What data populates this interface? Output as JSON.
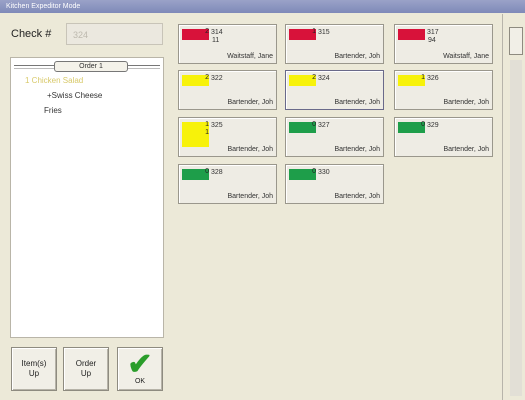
{
  "window": {
    "title": "Kitchen Expeditor Mode"
  },
  "check": {
    "label": "Check #",
    "value": "324"
  },
  "order": {
    "header": "Order 1",
    "items": [
      "1 Chicken Salad",
      "+Swiss Cheese",
      "Fries"
    ]
  },
  "buttons": {
    "items_up": [
      "Item(s)",
      "Up"
    ],
    "order_up": [
      "Order",
      "Up"
    ],
    "ok": "OK"
  },
  "colors": {
    "red": "#d8123a",
    "yellow": "#f7f20a",
    "green": "#1e9e4a"
  },
  "tickets": [
    {
      "color": "red",
      "count": "2",
      "number": "314",
      "sub": "11",
      "server": "Waitstaff, Jane"
    },
    {
      "color": "red",
      "count": "1",
      "number": "315",
      "sub": "",
      "server": "Bartender, Joh"
    },
    {
      "color": "red",
      "count": "",
      "number": "317",
      "sub": "94",
      "server": "Waitstaff, Jane"
    },
    {
      "color": "yellow",
      "count": "2",
      "number": "322",
      "sub": "",
      "server": "Bartender, Joh"
    },
    {
      "color": "yellow",
      "count": "2",
      "number": "324",
      "sub": "",
      "server": "Bartender, Joh"
    },
    {
      "color": "yellow",
      "count": "1",
      "number": "326",
      "sub": "",
      "server": "Bartender, Joh"
    },
    {
      "color": "yellow",
      "count": "1",
      "count2": "1",
      "number": "325",
      "sub": "",
      "server": "Bartender, Joh"
    },
    {
      "color": "green",
      "count": "0",
      "number": "327",
      "sub": "",
      "server": "Bartender, Joh"
    },
    {
      "color": "green",
      "count": "0",
      "number": "329",
      "sub": "",
      "server": "Bartender, Joh"
    },
    {
      "color": "green",
      "count": "0",
      "number": "328",
      "sub": "",
      "server": "Bartender, Joh"
    },
    {
      "color": "green",
      "count": "0",
      "number": "330",
      "sub": "",
      "server": "Bartender, Joh"
    }
  ]
}
